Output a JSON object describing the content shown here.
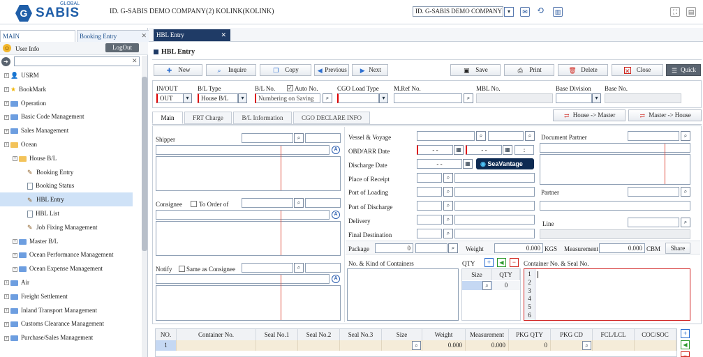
{
  "topbar": {
    "logo_global": "GLOBAL",
    "logo_text": "SABIS",
    "company_label": "ID. G-SABIS DEMO COMPANY(2) KOLINK(KOLINK)",
    "company_select": "ID. G-SABIS DEMO COMPANY"
  },
  "sidebar": {
    "tabs": [
      "MAIN",
      "Booking Entry"
    ],
    "user_info": "User Info",
    "logout": "LogOut",
    "tree": [
      {
        "label": "USRM",
        "level": 0,
        "icon": "user",
        "plus": true
      },
      {
        "label": "BookMark",
        "level": 0,
        "icon": "star",
        "plus": true
      },
      {
        "label": "Operation",
        "level": 0,
        "icon": "folder",
        "plus": true
      },
      {
        "label": "Basic Code Management",
        "level": 0,
        "icon": "folder",
        "plus": true
      },
      {
        "label": "Sales Management",
        "level": 0,
        "icon": "folder",
        "plus": true
      },
      {
        "label": "Ocean",
        "level": 0,
        "icon": "folder-open",
        "plus": true
      },
      {
        "label": "House B/L",
        "level": 1,
        "icon": "folder-open",
        "plus": true
      },
      {
        "label": "Booking Entry",
        "level": 2,
        "icon": "pen",
        "plus": false
      },
      {
        "label": "Booking Status",
        "level": 2,
        "icon": "doc",
        "plus": false
      },
      {
        "label": "HBL Entry",
        "level": 2,
        "icon": "pen",
        "plus": false,
        "selected": true
      },
      {
        "label": "HBL List",
        "level": 2,
        "icon": "doc",
        "plus": false
      },
      {
        "label": "Job Fixing Management",
        "level": 2,
        "icon": "pen",
        "plus": false
      },
      {
        "label": "Master B/L",
        "level": 1,
        "icon": "folder",
        "plus": true
      },
      {
        "label": "Ocean Performance Management",
        "level": 1,
        "icon": "folder",
        "plus": true
      },
      {
        "label": "Ocean Expense Management",
        "level": 1,
        "icon": "folder",
        "plus": true
      },
      {
        "label": "Air",
        "level": 0,
        "icon": "folder",
        "plus": true
      },
      {
        "label": "Freight Settlement",
        "level": 0,
        "icon": "folder",
        "plus": true
      },
      {
        "label": "Inland Transport Management",
        "level": 0,
        "icon": "folder",
        "plus": true
      },
      {
        "label": "Customs Clearance Management",
        "level": 0,
        "icon": "folder",
        "plus": true
      },
      {
        "label": "Purchase/Sales Management",
        "level": 0,
        "icon": "folder",
        "plus": true
      }
    ]
  },
  "main": {
    "tab": "HBL Entry",
    "title": "HBL Entry",
    "toolbar": {
      "new": "New",
      "inquire": "Inquire",
      "copy": "Copy",
      "previous": "Previous",
      "next": "Next",
      "save": "Save",
      "print": "Print",
      "delete": "Delete",
      "close": "Close",
      "quick": "Quick"
    },
    "header_fields": {
      "inout_label": "IN/OUT",
      "inout_value": "OUT",
      "bltype_label": "B/L Type",
      "bltype_value": "House B/L",
      "blno_label": "B/L No.",
      "auto_no": "Auto No.",
      "blno_value": "Numbering on Saving",
      "cgo_load_label": "CGO Load Type",
      "mref_label": "M.Ref No.",
      "mbl_label": "MBL No.",
      "base_div_label": "Base Division",
      "base_no_label": "Base No."
    },
    "subtabs": [
      "Main",
      "FRT Charge",
      "B/L Information",
      "CGO DECLARE INFO"
    ],
    "house_master": "House -> Master",
    "master_house": "Master -> House",
    "form": {
      "shipper": "Shipper",
      "consignee": "Consignee",
      "to_order_of": "To Order of",
      "notify": "Notify",
      "same_as_consignee": "Same as Consignee",
      "vessel_voyage": "Vessel & Voyage",
      "obd_arr": "OBD/ARR Date",
      "discharge_date": "Discharge Date",
      "place_of_receipt": "Place of Receipt",
      "port_of_loading": "Port of Loading",
      "port_of_discharge": "Port of Discharge",
      "delivery": "Delivery",
      "final_destination": "Final Destination",
      "document_partner": "Document Partner",
      "partner": "Partner",
      "line": "Line",
      "date_placeholder": "-  -",
      "time_placeholder": ":",
      "seavantage": "SeaVantage"
    },
    "package_row": {
      "package_label": "Package",
      "package_value": "0",
      "weight_label": "Weight",
      "weight_value": "0.000",
      "weight_unit": "KGS",
      "measurement_label": "Measurement",
      "measurement_value": "0.000",
      "measurement_unit": "CBM",
      "share": "Share"
    },
    "containers": {
      "kind_label": "No. & Kind of Containers",
      "qty_label": "QTY",
      "size_col": "Size",
      "qty_col": "QTY",
      "qty_value": "0",
      "seal_label": "Container No. & Seal No.",
      "line_numbers": [
        "1",
        "2",
        "3",
        "4",
        "5",
        "6"
      ]
    },
    "grid": {
      "columns": [
        "NO.",
        "Container No.",
        "Seal No.1",
        "Seal No.2",
        "Seal No.3",
        "Size",
        "Weight",
        "Measurement",
        "PKG QTY",
        "PKG CD",
        "FCL/LCL",
        "COC/SOC"
      ],
      "row": {
        "no": "1",
        "weight": "0.000",
        "measurement": "0.000",
        "pkg_qty": "0"
      }
    }
  }
}
